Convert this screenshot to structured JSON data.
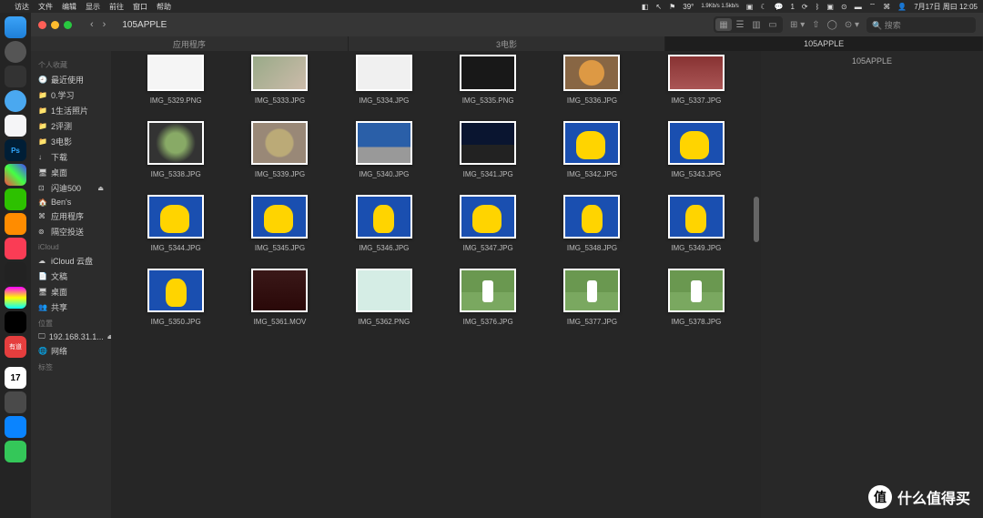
{
  "menubar": {
    "app": "访达",
    "items": [
      "文件",
      "编辑",
      "显示",
      "前往",
      "窗口",
      "帮助"
    ],
    "right": {
      "temp": "39°",
      "net": "1.9Kb/s\n1.5kb/s",
      "badge": "1",
      "date": "7月17日 周曰 12:05"
    }
  },
  "window": {
    "title": "105APPLE",
    "search_placeholder": "搜索",
    "tabs": [
      {
        "label": "应用程序",
        "active": false
      },
      {
        "label": "3电影",
        "active": false
      },
      {
        "label": "105APPLE",
        "active": true
      }
    ]
  },
  "sidebar": {
    "sections": [
      {
        "title": "个人收藏",
        "items": [
          {
            "icon": "clock",
            "label": "最近使用"
          },
          {
            "icon": "folder",
            "label": "0.学习"
          },
          {
            "icon": "folder",
            "label": "1生活照片"
          },
          {
            "icon": "folder",
            "label": "2评测"
          },
          {
            "icon": "folder",
            "label": "3电影"
          },
          {
            "icon": "download",
            "label": "下载"
          },
          {
            "icon": "desktop",
            "label": "桌面"
          },
          {
            "icon": "disk",
            "label": "闪迪500",
            "eject": true
          },
          {
            "icon": "home",
            "label": "Ben's"
          },
          {
            "icon": "apps",
            "label": "应用程序"
          },
          {
            "icon": "airdrop",
            "label": "隔空投送"
          }
        ]
      },
      {
        "title": "iCloud",
        "items": [
          {
            "icon": "cloud",
            "label": "iCloud 云盘"
          },
          {
            "icon": "doc",
            "label": "文稿"
          },
          {
            "icon": "desktop",
            "label": "桌面"
          },
          {
            "icon": "share",
            "label": "共享"
          }
        ]
      },
      {
        "title": "位置",
        "items": [
          {
            "icon": "screen",
            "label": "192.168.31.1...",
            "eject": true
          },
          {
            "icon": "globe",
            "label": "网络"
          }
        ]
      },
      {
        "title": "标签",
        "items": []
      }
    ]
  },
  "dock": {
    "calendar_day": "17",
    "ps_label": "Ps",
    "red_label": "有道"
  },
  "files": [
    {
      "name": "IMG_5329.PNG",
      "cls": "t-white"
    },
    {
      "name": "IMG_5333.JPG",
      "cls": "t-metal"
    },
    {
      "name": "IMG_5334.JPG",
      "cls": "t-box"
    },
    {
      "name": "IMG_5335.PNG",
      "cls": "t-dark"
    },
    {
      "name": "IMG_5336.JPG",
      "cls": "t-food1"
    },
    {
      "name": "IMG_5337.JPG",
      "cls": "t-meat"
    },
    {
      "name": "IMG_5338.JPG",
      "cls": "t-food2"
    },
    {
      "name": "IMG_5339.JPG",
      "cls": "t-food3"
    },
    {
      "name": "IMG_5340.JPG",
      "cls": "t-sky"
    },
    {
      "name": "IMG_5341.JPG",
      "cls": "t-night"
    },
    {
      "name": "IMG_5342.JPG",
      "cls": "t-pika"
    },
    {
      "name": "IMG_5343.JPG",
      "cls": "t-pika"
    },
    {
      "name": "IMG_5344.JPG",
      "cls": "t-pika"
    },
    {
      "name": "IMG_5345.JPG",
      "cls": "t-pika"
    },
    {
      "name": "IMG_5346.JPG",
      "cls": "t-pika t-pika2"
    },
    {
      "name": "IMG_5347.JPG",
      "cls": "t-pika"
    },
    {
      "name": "IMG_5348.JPG",
      "cls": "t-pika t-pika2"
    },
    {
      "name": "IMG_5349.JPG",
      "cls": "t-pika t-pika2"
    },
    {
      "name": "IMG_5350.JPG",
      "cls": "t-pika t-pika2"
    },
    {
      "name": "IMG_5361.MOV",
      "cls": "t-mov"
    },
    {
      "name": "IMG_5362.PNG",
      "cls": "t-app"
    },
    {
      "name": "IMG_5376.JPG",
      "cls": "t-person"
    },
    {
      "name": "IMG_5377.JPG",
      "cls": "t-person"
    },
    {
      "name": "IMG_5378.JPG",
      "cls": "t-person"
    }
  ],
  "preview": {
    "title": "105APPLE"
  },
  "watermark": {
    "text": "什么值得买",
    "icon": "值"
  }
}
